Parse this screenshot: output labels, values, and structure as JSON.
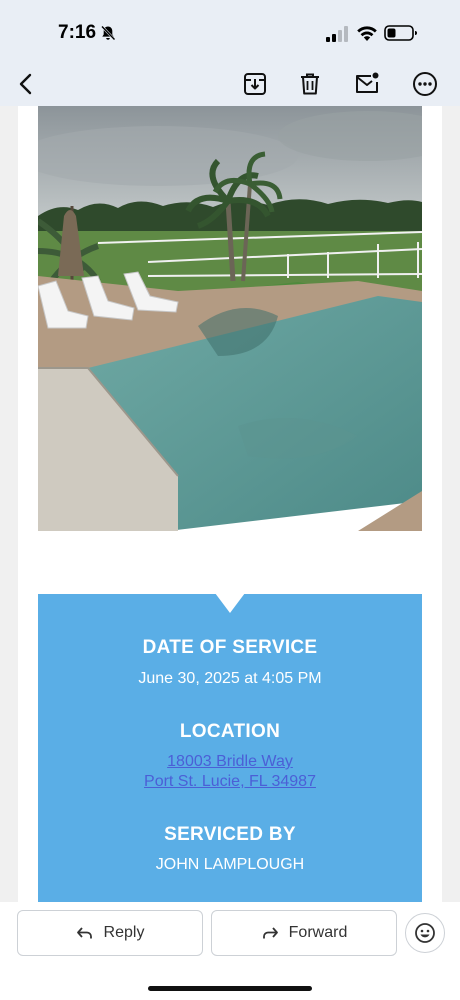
{
  "status_bar": {
    "time": "7:16",
    "icons": [
      "bell-slash-icon",
      "cellular-signal-icon",
      "wifi-icon",
      "battery-icon"
    ]
  },
  "toolbar": {
    "icons": [
      "back-arrow-icon",
      "archive-icon",
      "trash-icon",
      "mark-unread-icon",
      "more-options-icon"
    ]
  },
  "email": {
    "photo": "pool-photo",
    "date_heading": "DATE OF SERVICE",
    "date_value": "June 30, 2025 at 4:05 PM",
    "location_heading": "LOCATION",
    "address_line1": "18003 Bridle Way",
    "address_line2": "Port St. Lucie, FL 34987",
    "serviced_heading": "SERVICED BY",
    "technician": "JOHN LAMPLOUGH",
    "colors": {
      "banner": "#5aaee6",
      "link": "#4b5fd6"
    }
  },
  "actions": {
    "reply_label": "Reply",
    "forward_label": "Forward",
    "emoji_icon": "smiley-icon"
  }
}
